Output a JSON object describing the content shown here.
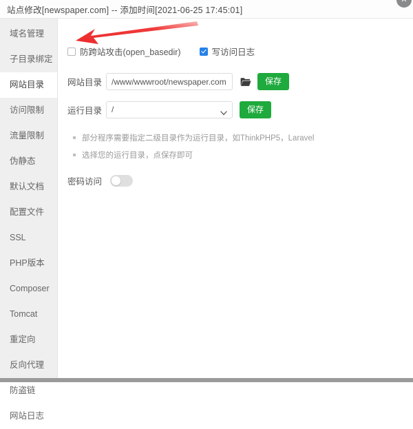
{
  "titlebar": {
    "title": "站点修改[newspaper.com] -- 添加时间[2021-06-25 17:45:01]",
    "close_label": "✕"
  },
  "sidebar": {
    "items": [
      {
        "label": "域名管理",
        "active": false
      },
      {
        "label": "子目录绑定",
        "active": false
      },
      {
        "label": "网站目录",
        "active": true
      },
      {
        "label": "访问限制",
        "active": false
      },
      {
        "label": "流量限制",
        "active": false
      },
      {
        "label": "伪静态",
        "active": false
      },
      {
        "label": "默认文档",
        "active": false
      },
      {
        "label": "配置文件",
        "active": false
      },
      {
        "label": "SSL",
        "active": false
      },
      {
        "label": "PHP版本",
        "active": false
      },
      {
        "label": "Composer",
        "active": false
      },
      {
        "label": "Tomcat",
        "active": false
      },
      {
        "label": "重定向",
        "active": false
      },
      {
        "label": "反向代理",
        "active": false
      },
      {
        "label": "防盗链",
        "active": false
      },
      {
        "label": "网站日志",
        "active": false
      }
    ]
  },
  "main": {
    "checkboxes": [
      {
        "label": "防跨站攻击(open_basedir)",
        "checked": false
      },
      {
        "label": "写访问日志",
        "checked": true
      }
    ],
    "site_dir": {
      "label": "网站目录",
      "value": "/www/wwwroot/newspaper.com",
      "placeholder": "/www/wwwroot/newspaper.com",
      "folder_icon": "folder-open-icon",
      "save_label": "保存"
    },
    "run_dir": {
      "label": "运行目录",
      "value": "/",
      "options": [
        "/"
      ],
      "save_label": "保存"
    },
    "hints": [
      "部分程序需要指定二级目录作为运行目录，如ThinkPHP5，Laravel",
      "选择您的运行目录，点保存即可"
    ],
    "password_access": {
      "label": "密码访问",
      "enabled": false
    }
  },
  "annotation": {
    "type": "arrow",
    "color": "#ef3030",
    "points_to": "防跨站攻击(open_basedir) 复选框"
  },
  "colors": {
    "accent_green": "#1faa3d",
    "checkbox_blue": "#2681e8",
    "sidebar_bg": "#efefef",
    "annotation_red": "#ef3030"
  }
}
